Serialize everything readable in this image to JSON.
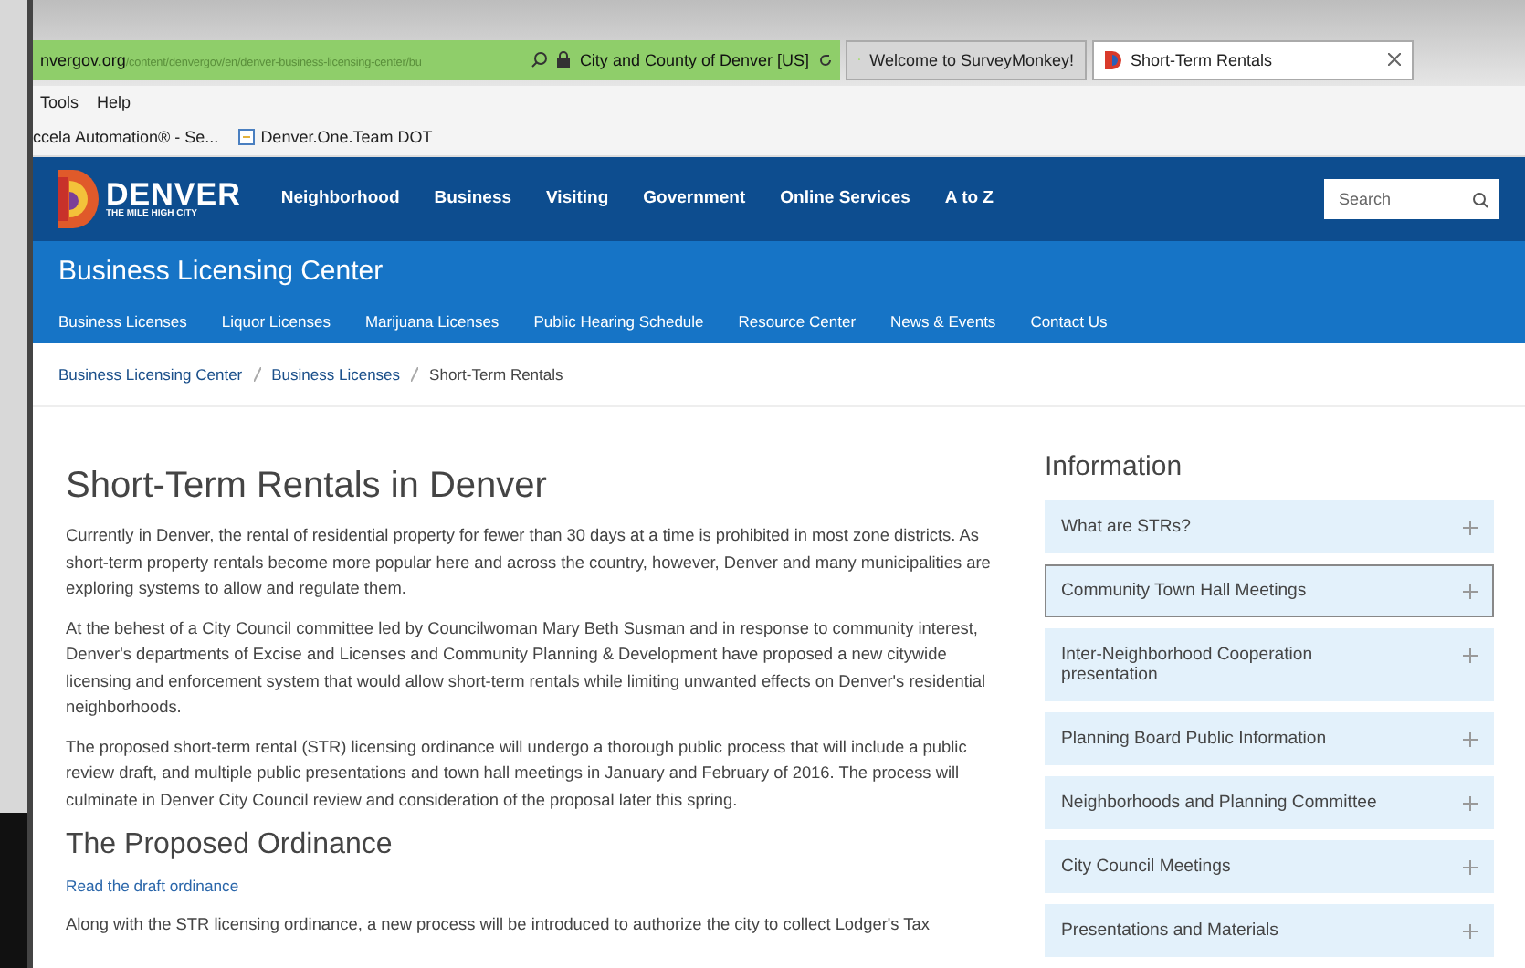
{
  "browser": {
    "address": {
      "host": "nvergov.org",
      "path": "/content/denvergov/en/denver-business-licensing-center/bu",
      "identity": "City and County of Denver [US]"
    },
    "tabs": [
      {
        "title": "Welcome to SurveyMonkey!",
        "selected": false
      },
      {
        "title": "Short-Term Rentals",
        "selected": true
      }
    ],
    "menu": [
      "Tools",
      "Help"
    ],
    "bookmarks": [
      "ccela Automation® - Se...",
      "Denver.One.Team DOT"
    ]
  },
  "site": {
    "logo": {
      "name": "DENVER",
      "tagline": "THE MILE HIGH CITY"
    },
    "nav": [
      "Neighborhood",
      "Business",
      "Visiting",
      "Government",
      "Online Services",
      "A to Z"
    ],
    "search": {
      "placeholder": "Search"
    },
    "section_title": "Business Licensing Center",
    "subnav": [
      "Business Licenses",
      "Liquor Licenses",
      "Marijuana Licenses",
      "Public Hearing Schedule",
      "Resource Center",
      "News & Events",
      "Contact Us"
    ],
    "breadcrumb": [
      "Business Licensing Center",
      "Business Licenses",
      "Short-Term Rentals"
    ]
  },
  "article": {
    "title": "Short-Term Rentals in Denver",
    "paragraphs": [
      "Currently in Denver, the rental of residential property for fewer than 30 days at a time is prohibited in most zone districts. As short-term property rentals become more popular here and across the country, however, Denver and many municipalities are exploring systems to allow and regulate them.",
      "At the behest of a City Council committee led by Councilwoman Mary Beth Susman and in response to community interest, Denver's departments of Excise and Licenses and Community Planning & Development have proposed a new citywide licensing and enforcement system that would allow short-term rentals while limiting unwanted effects on Denver's residential neighborhoods.",
      "The proposed short-term rental (STR) licensing ordinance will undergo a thorough public process that will include a public review draft, and multiple public presentations and town hall meetings in January and February of 2016. The process will culminate in Denver City Council review and consideration of the proposal later this spring."
    ],
    "heading": "The Proposed Ordinance",
    "link": "Read the draft ordinance",
    "last_paragraph": "Along with the STR licensing ordinance, a new process will be introduced to authorize the city to collect Lodger's Tax"
  },
  "sidebar": {
    "title": "Information",
    "items": [
      {
        "label": "What are STRs?",
        "selected": false,
        "expanded": false
      },
      {
        "label": "Community Town Hall Meetings",
        "selected": true,
        "expanded": false
      },
      {
        "label": "Inter-Neighborhood Cooperation presentation",
        "selected": false,
        "expanded": false
      },
      {
        "label": "Planning Board Public Information",
        "selected": false,
        "expanded": false
      },
      {
        "label": "Neighborhoods and Planning Committee",
        "selected": false,
        "expanded": false
      },
      {
        "label": "City Council Meetings",
        "selected": false,
        "expanded": false
      },
      {
        "label": "Presentations and Materials",
        "selected": false,
        "expanded": false
      }
    ]
  }
}
